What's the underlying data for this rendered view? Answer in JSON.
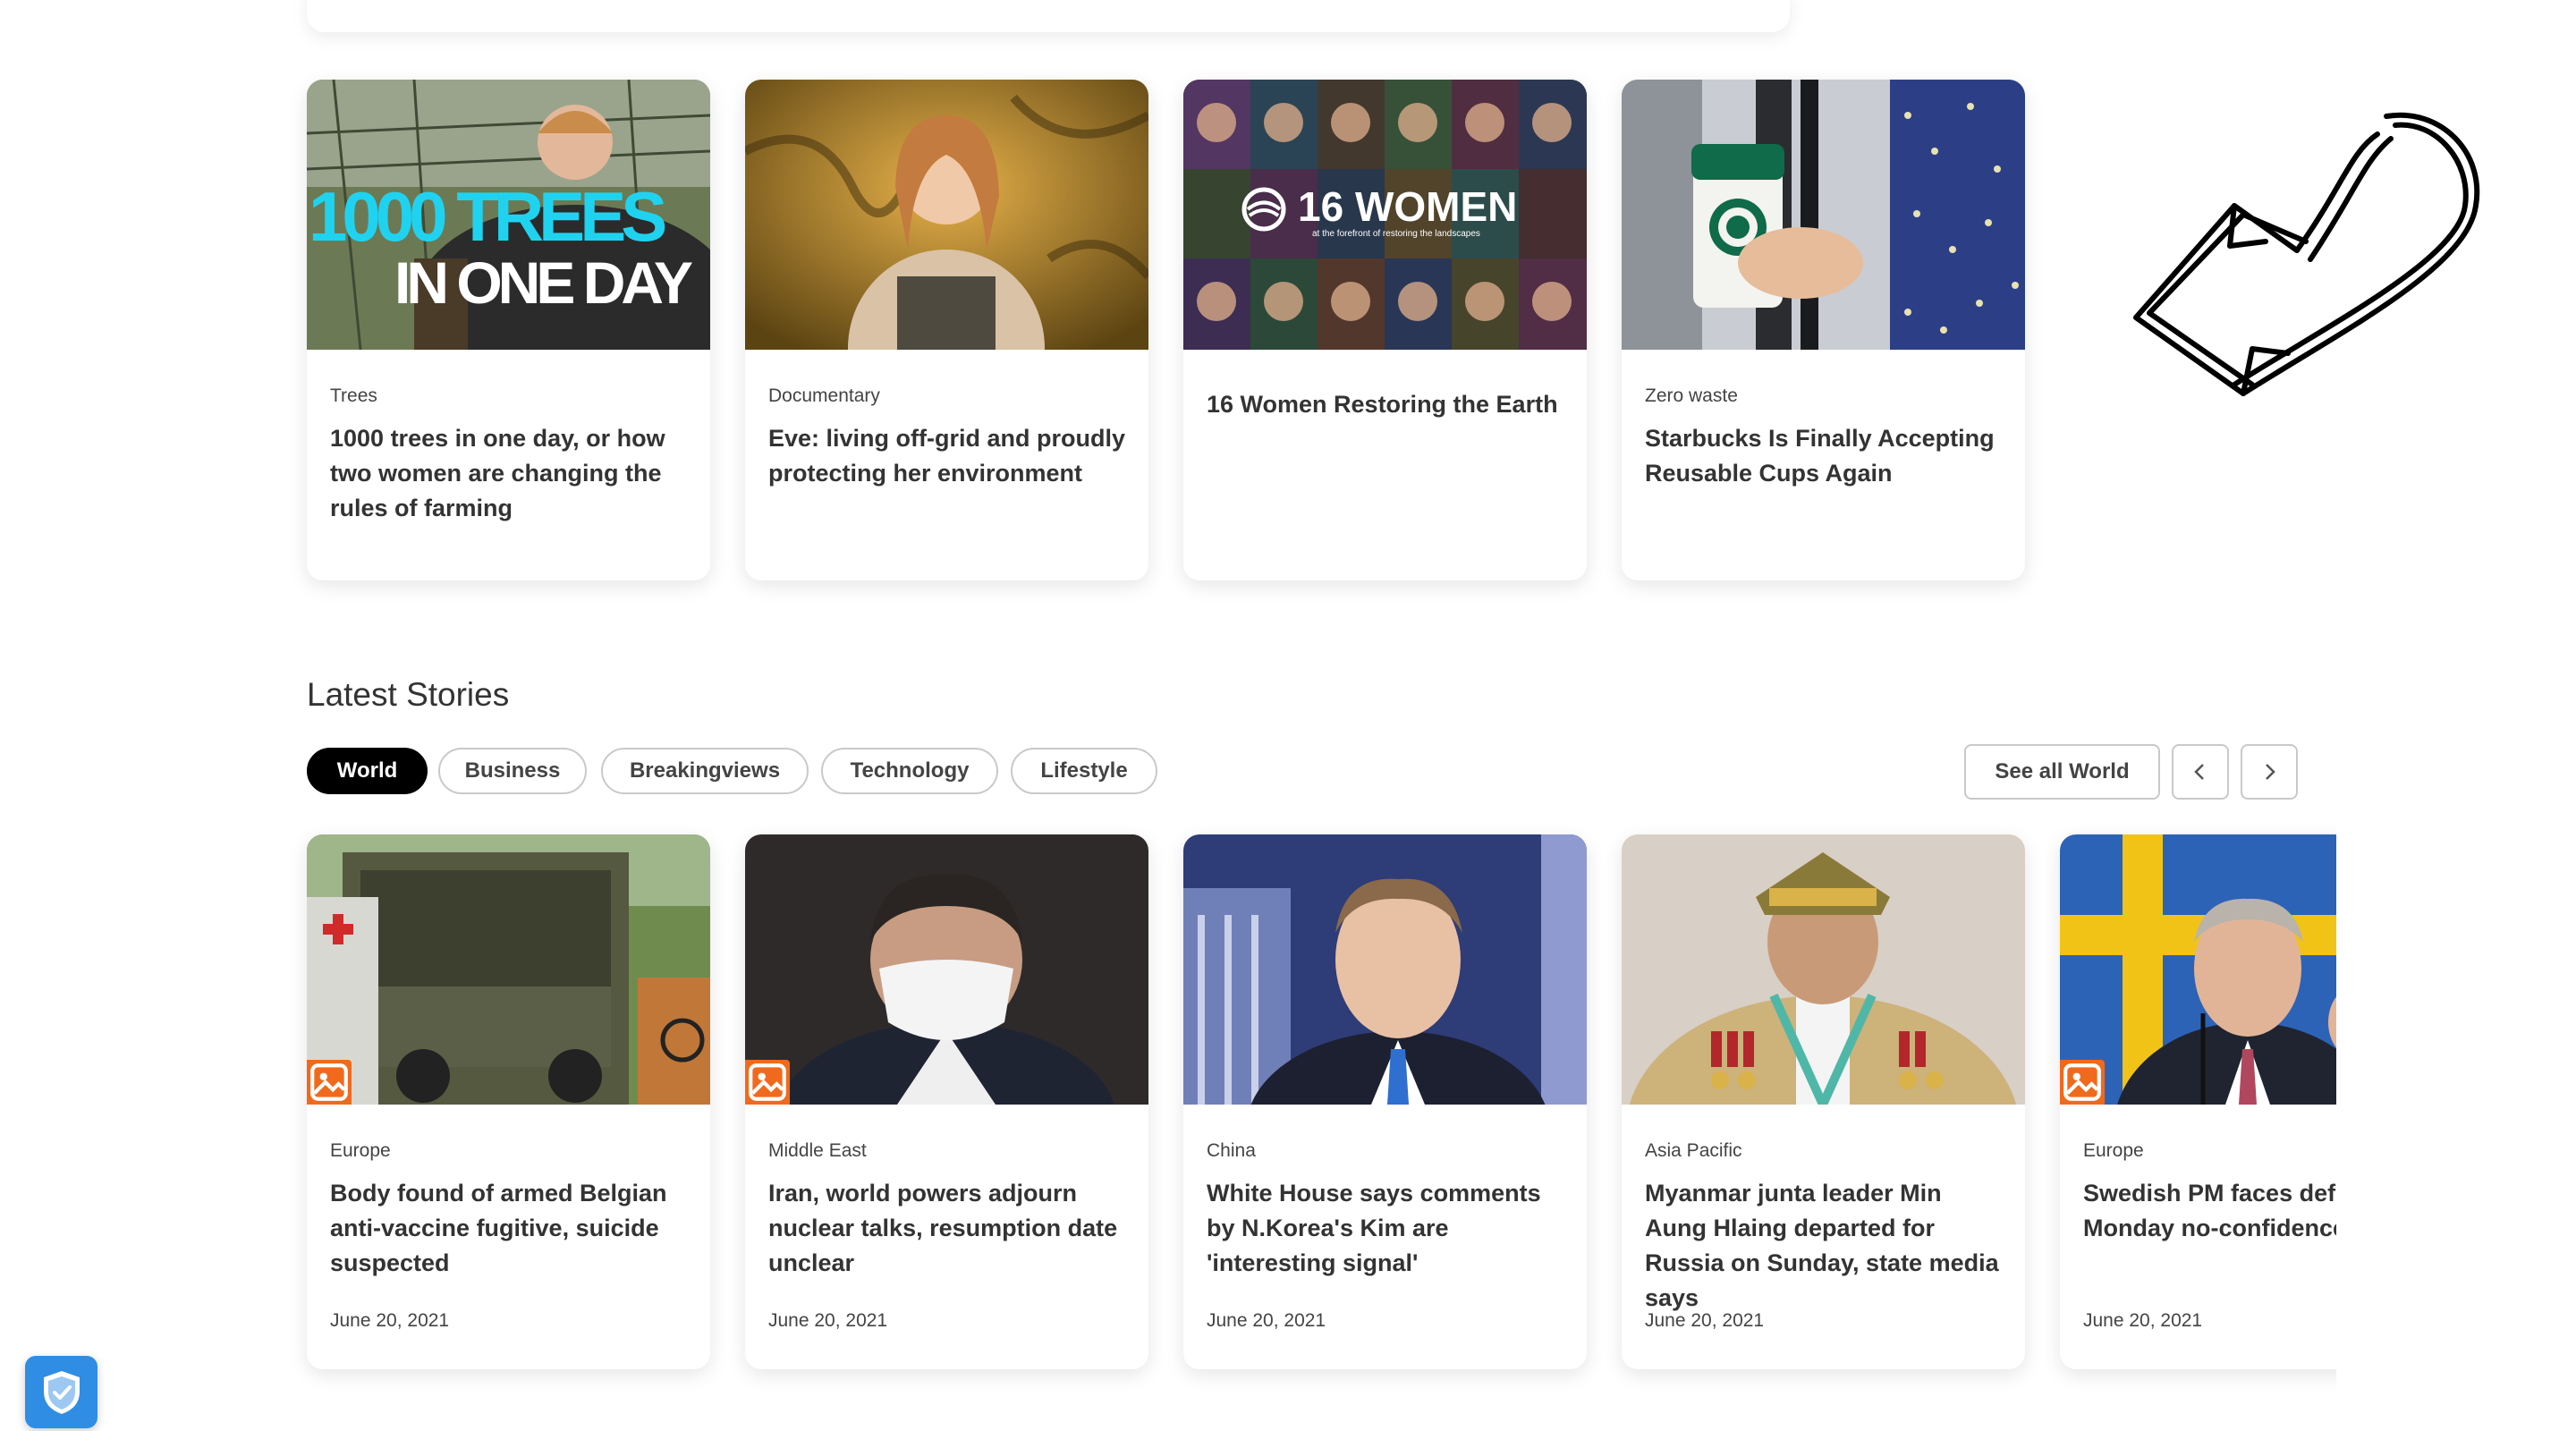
{
  "featured": [
    {
      "kicker": "Trees",
      "title": "1000 trees in one day, or how two women are changing the rules of farming",
      "overlay_line1": "1000 TREES",
      "overlay_line2": "IN ONE DAY"
    },
    {
      "kicker": "Documentary",
      "title": "Eve: living off-grid and proudly protecting her environment"
    },
    {
      "kicker": "",
      "title": "16 Women Restoring the Earth",
      "overlay_big": "16 WOMEN",
      "overlay_small": "at the forefront of restoring the landscapes"
    },
    {
      "kicker": "Zero waste",
      "title": "Starbucks Is Finally Accepting Reusable Cups Again"
    }
  ],
  "latest": {
    "heading": "Latest Stories",
    "tabs": [
      "World",
      "Business",
      "Breakingviews",
      "Technology",
      "Lifestyle"
    ],
    "active_tab": "World",
    "see_all_label": "See all World",
    "stories": [
      {
        "kicker": "Europe",
        "title": "Body found of armed Belgian anti-vaccine fugitive, suicide suspected",
        "date": "June 20, 2021",
        "photo_badge": true
      },
      {
        "kicker": "Middle East",
        "title": "Iran, world powers adjourn nuclear talks, resumption date unclear",
        "date": "June 20, 2021",
        "photo_badge": true
      },
      {
        "kicker": "China",
        "title": "White House says comments by N.Korea's Kim are 'interesting signal'",
        "date": "June 20, 2021",
        "photo_badge": false
      },
      {
        "kicker": "Asia Pacific",
        "title": "Myanmar junta leader Min Aung Hlaing departed for Russia on Sunday, state media says",
        "date": "June 20, 2021",
        "photo_badge": false
      },
      {
        "kicker": "Europe",
        "title": "Swedish PM faces defeat in Monday no-confidence vote",
        "date": "June 20, 2021",
        "photo_badge": true
      }
    ]
  },
  "colors": {
    "accent_orange": "#f06a1d",
    "shield_blue": "#2f8de4",
    "active_pill": "#000000"
  },
  "icons": [
    "photo-icon",
    "chevron-left-icon",
    "chevron-right-icon",
    "shield-check-icon",
    "hand-drawn-arrow-icon"
  ]
}
